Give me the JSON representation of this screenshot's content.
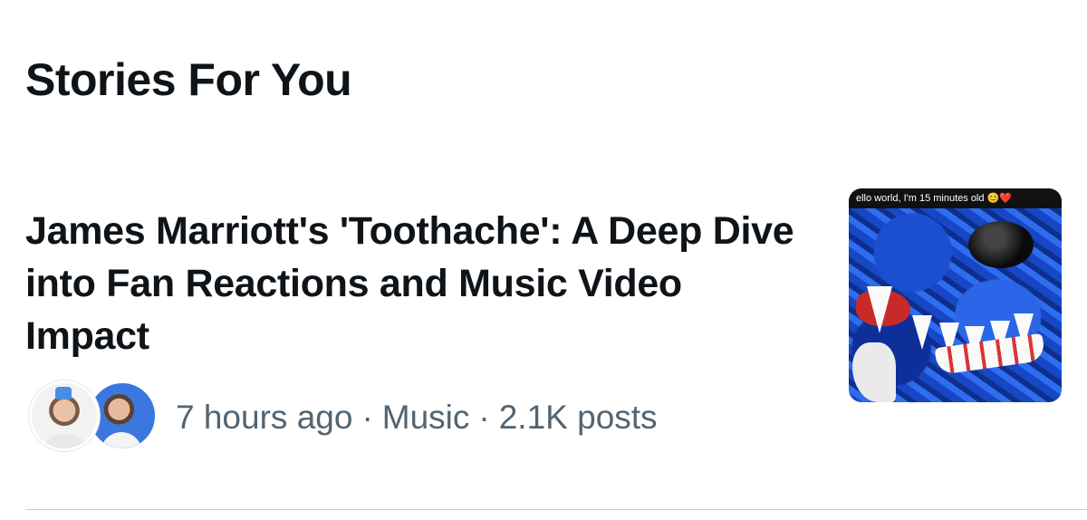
{
  "section": {
    "title": "Stories For You"
  },
  "story": {
    "headline": "James Marriott's 'Toothache': A Deep Dive into Fan Reactions and Music Video Impact",
    "meta": {
      "time": "7 hours ago",
      "separator": "·",
      "category": "Music",
      "posts": "2.1K posts"
    },
    "thumbnail": {
      "caption": "ello world, I'm 15 minutes old 😊❤️"
    },
    "avatars": [
      "avatar",
      "avatar"
    ]
  },
  "colors": {
    "text_primary": "#0f1419",
    "text_secondary": "#536471",
    "divider": "#c9ced3",
    "background": "#ffffff"
  }
}
